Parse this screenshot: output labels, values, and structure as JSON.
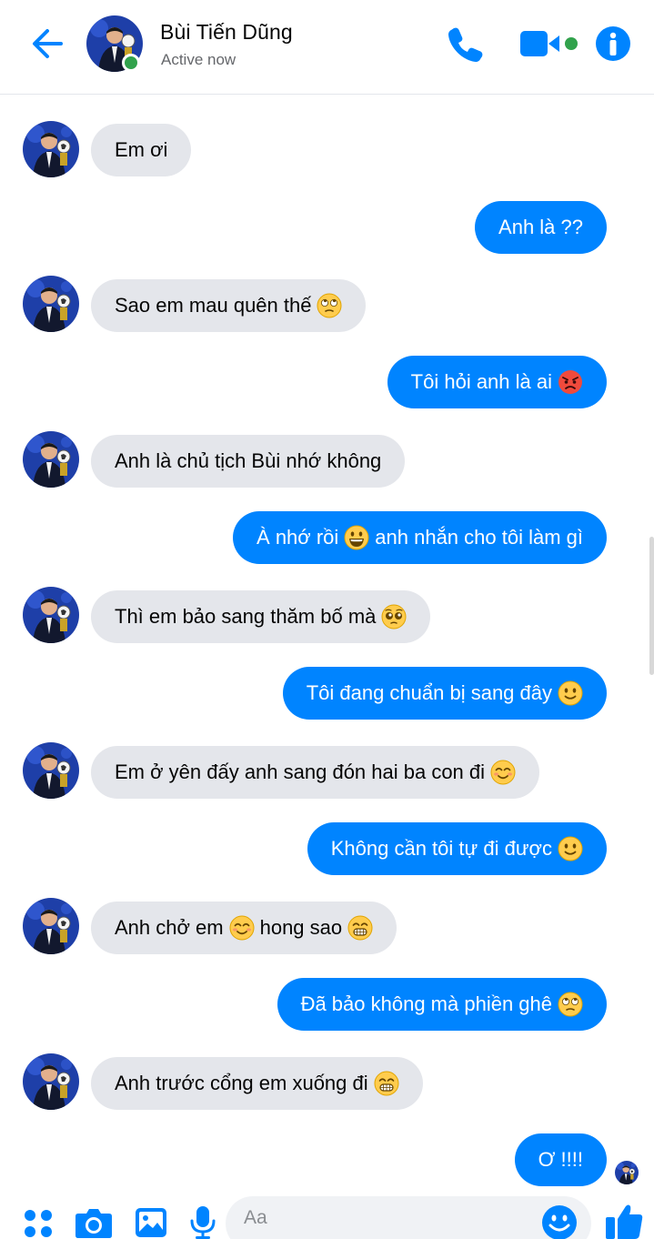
{
  "header": {
    "contact_name": "Bùi Tiến Dũng",
    "status": "Active now",
    "icons": [
      "back-arrow-icon",
      "phone-icon",
      "video-camera-icon",
      "info-icon"
    ],
    "accent_color": "#0084ff"
  },
  "messages": [
    {
      "side": "in",
      "text": "Em ơi",
      "emoji_after": null
    },
    {
      "side": "out",
      "text": "Anh là ??",
      "emoji_after": null
    },
    {
      "side": "in",
      "text": "Sao em mau quên thế",
      "emoji_after": "eye-roll-emoji"
    },
    {
      "side": "out",
      "text": "Tôi hỏi anh là ai",
      "emoji_after": "angry-face-emoji"
    },
    {
      "side": "in",
      "text": "Anh là chủ tịch Bùi nhớ không",
      "emoji_after": null
    },
    {
      "side": "out",
      "text_before": "À nhớ rồi",
      "emoji_mid": "grinning-face-emoji",
      "text_after": "anh nhắn cho tôi làm gì"
    },
    {
      "side": "in",
      "text": "Thì em bảo sang thăm bố mà",
      "emoji_after": "pleading-face-emoji"
    },
    {
      "side": "out",
      "text": "Tôi đang chuẩn bị sang đây",
      "emoji_after": "slight-smile-emoji"
    },
    {
      "side": "in",
      "text": "Em ở yên đấy anh sang đón hai ba con đi",
      "emoji_after": "smiling-blush-emoji"
    },
    {
      "side": "out",
      "text": "Không cần tôi tự đi được",
      "emoji_after": "slight-smile-emoji"
    },
    {
      "side": "in",
      "text_before": "Anh chở em",
      "emoji_mid": "smiling-blush-emoji",
      "text_after": "hong sao",
      "emoji_after": "beaming-grin-emoji"
    },
    {
      "side": "out",
      "text": "Đã bảo không mà phiền ghê",
      "emoji_after": "eye-roll-emoji"
    },
    {
      "side": "in",
      "text": "Anh trước cổng em xuống đi",
      "emoji_after": "beaming-grin-emoji"
    },
    {
      "side": "out",
      "text": "Ơ !!!!",
      "emoji_after": null
    }
  ],
  "composer": {
    "placeholder": "Aa",
    "icons": [
      "menu-dots-icon",
      "camera-icon",
      "gallery-icon",
      "microphone-icon",
      "emoji-icon",
      "thumbs-up-icon"
    ]
  }
}
